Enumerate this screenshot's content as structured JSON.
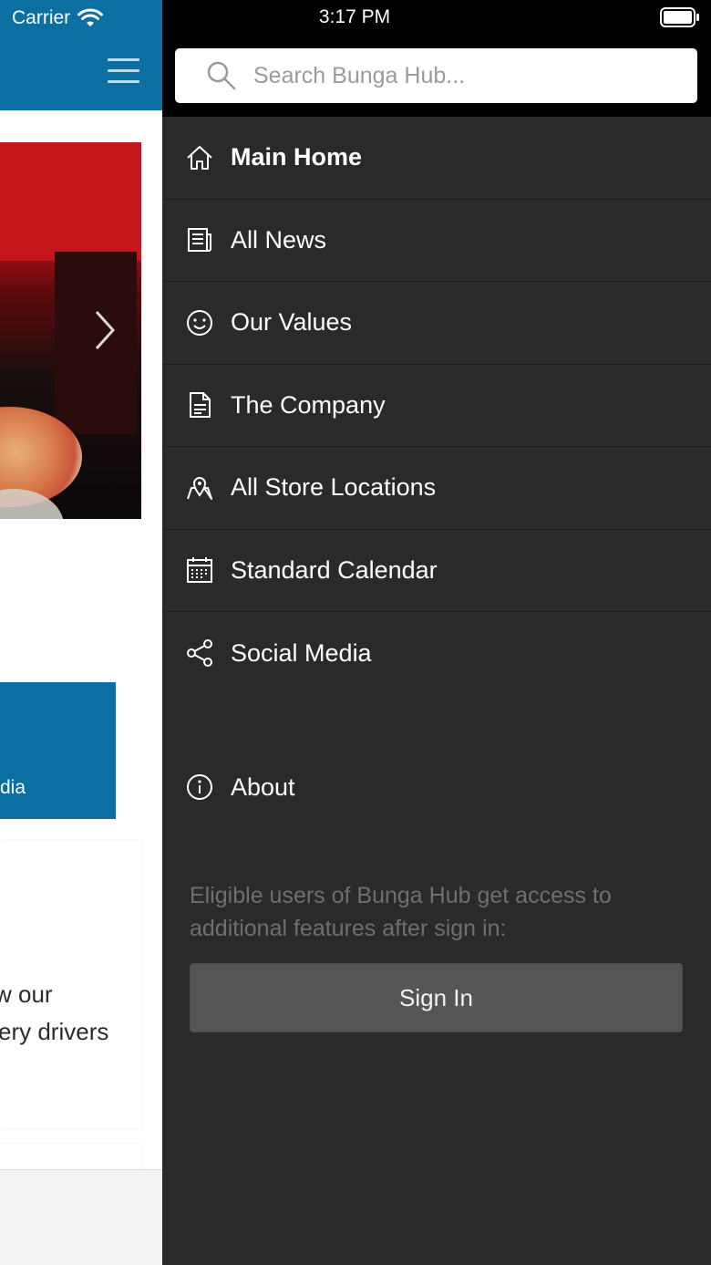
{
  "status_bar": {
    "carrier": "Carrier",
    "time": "3:17 PM"
  },
  "background_app": {
    "blue_card_label": "dia",
    "news_text_line1": "w our",
    "news_text_line2": "ery drivers",
    "brand_color": "#0b6fa2"
  },
  "search": {
    "placeholder": "Search Bunga Hub..."
  },
  "menu": {
    "items": [
      {
        "label": "Main Home",
        "icon": "home-icon"
      },
      {
        "label": "All News",
        "icon": "newspaper-icon"
      },
      {
        "label": "Our Values",
        "icon": "smiley-icon"
      },
      {
        "label": "The Company",
        "icon": "document-icon"
      },
      {
        "label": "All Store Locations",
        "icon": "map-pin-icon"
      },
      {
        "label": "Standard Calendar",
        "icon": "calendar-icon"
      },
      {
        "label": "Social Media",
        "icon": "share-icon"
      }
    ],
    "about": {
      "label": "About",
      "icon": "info-icon"
    }
  },
  "sign_in": {
    "info": "Eligible users of Bunga Hub get access to additional features after sign in:",
    "button_label": "Sign In"
  },
  "colors": {
    "drawer_bg": "#2a2a2a",
    "button_bg": "#555555"
  }
}
